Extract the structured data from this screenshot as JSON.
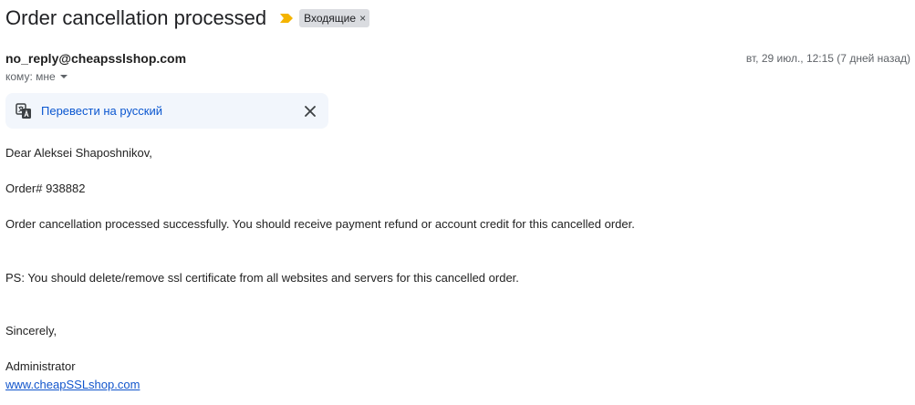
{
  "email": {
    "subject": "Order cancellation processed",
    "importance_icon": "importance-marker-icon",
    "label_chip": "Входящие",
    "label_remove": "×",
    "sender": "no_reply@cheapsslshop.com",
    "date": "вт, 29 июл., 12:15 (7 дней назад)",
    "to": "кому: мне"
  },
  "translate": {
    "icon": "translate-icon",
    "link": "Перевести на русский",
    "close_icon": "close-icon"
  },
  "message": {
    "greeting": "Dear  Aleksei Shaposhnikov,",
    "order": "Order# 938882",
    "line1": "Order cancellation processed successfully. You should receive payment refund or account credit for this cancelled order.",
    "ps": "PS: You should delete/remove ssl certificate from all websites and servers for this cancelled order.",
    "closing": "Sincerely,",
    "signature": "Administrator",
    "website": "www.cheapSSLshop.com"
  },
  "colors": {
    "importance": "#f4b400",
    "link": "#1155cc",
    "translate_link": "#0b57d0",
    "translate_bg": "#f2f6fc",
    "chip_bg": "#dadce0"
  }
}
